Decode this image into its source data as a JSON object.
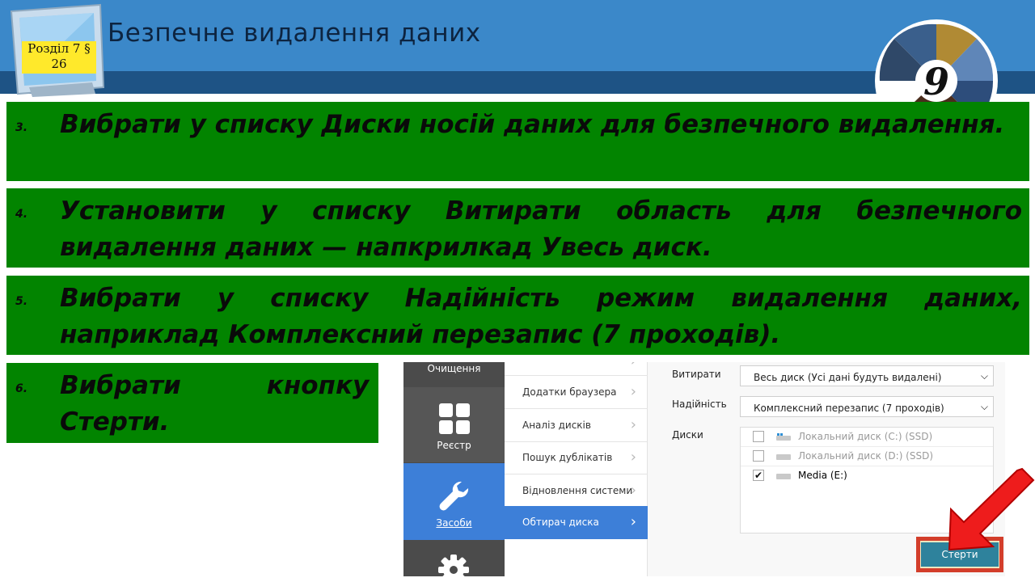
{
  "header": {
    "title": "Безпечне видалення даних",
    "section_badge": [
      "Розділ 7 §",
      "26"
    ],
    "grade_number": "9"
  },
  "steps": [
    {
      "num": "3.",
      "text": "Вибрати у списку Диски носій даних для безпечного видалення."
    },
    {
      "num": "4.",
      "text": "Установити у списку Витирати область для безпечного видалення даних — напкрилкад Увесь диск."
    },
    {
      "num": "5.",
      "text": "Вибрати у списку Надійність режим видалення даних, наприклад Комплексний перезапис (7 проходів)."
    },
    {
      "num": "6.",
      "text_first": "Вибрати",
      "text_second": "кнопку",
      "text_rest": "Стерти."
    }
  ],
  "app": {
    "nav": [
      {
        "label": "Очищення",
        "icon": "broom-icon"
      },
      {
        "label": "Реєстр",
        "icon": "grid-icon"
      },
      {
        "label": "Засоби",
        "icon": "wrench-icon",
        "active": true
      },
      {
        "label": "",
        "icon": "gear-icon"
      }
    ],
    "submenu": [
      {
        "label": "Додатки браузера"
      },
      {
        "label": "Аналіз дисків"
      },
      {
        "label": "Пошук дублікатів"
      },
      {
        "label": "Відновлення системи"
      },
      {
        "label": "Обтирач диска",
        "active": true
      }
    ],
    "wipe": {
      "label": "Витирати",
      "value": "Весь диск (Усі дані будуть видалені)"
    },
    "reliability": {
      "label": "Надійність",
      "value": "Комплексний перезапис (7 проходів)"
    },
    "disks": {
      "label": "Диски",
      "items": [
        {
          "name": "Локальний диск (C:) (SSD)",
          "checked": false
        },
        {
          "name": "Локальний диск (D:) (SSD)",
          "checked": false
        },
        {
          "name": "Media (E:)",
          "checked": true
        }
      ]
    },
    "erase_button": "Стерти"
  },
  "colors": {
    "header_blue": "#3b88c9",
    "header_dark": "#1e5385",
    "step_green": "#028400",
    "badge_yellow": "#ffe92b",
    "app_active_blue": "#3d7fd8",
    "erase_button": "#2e829c",
    "highlight_red": "#d33e2b"
  }
}
